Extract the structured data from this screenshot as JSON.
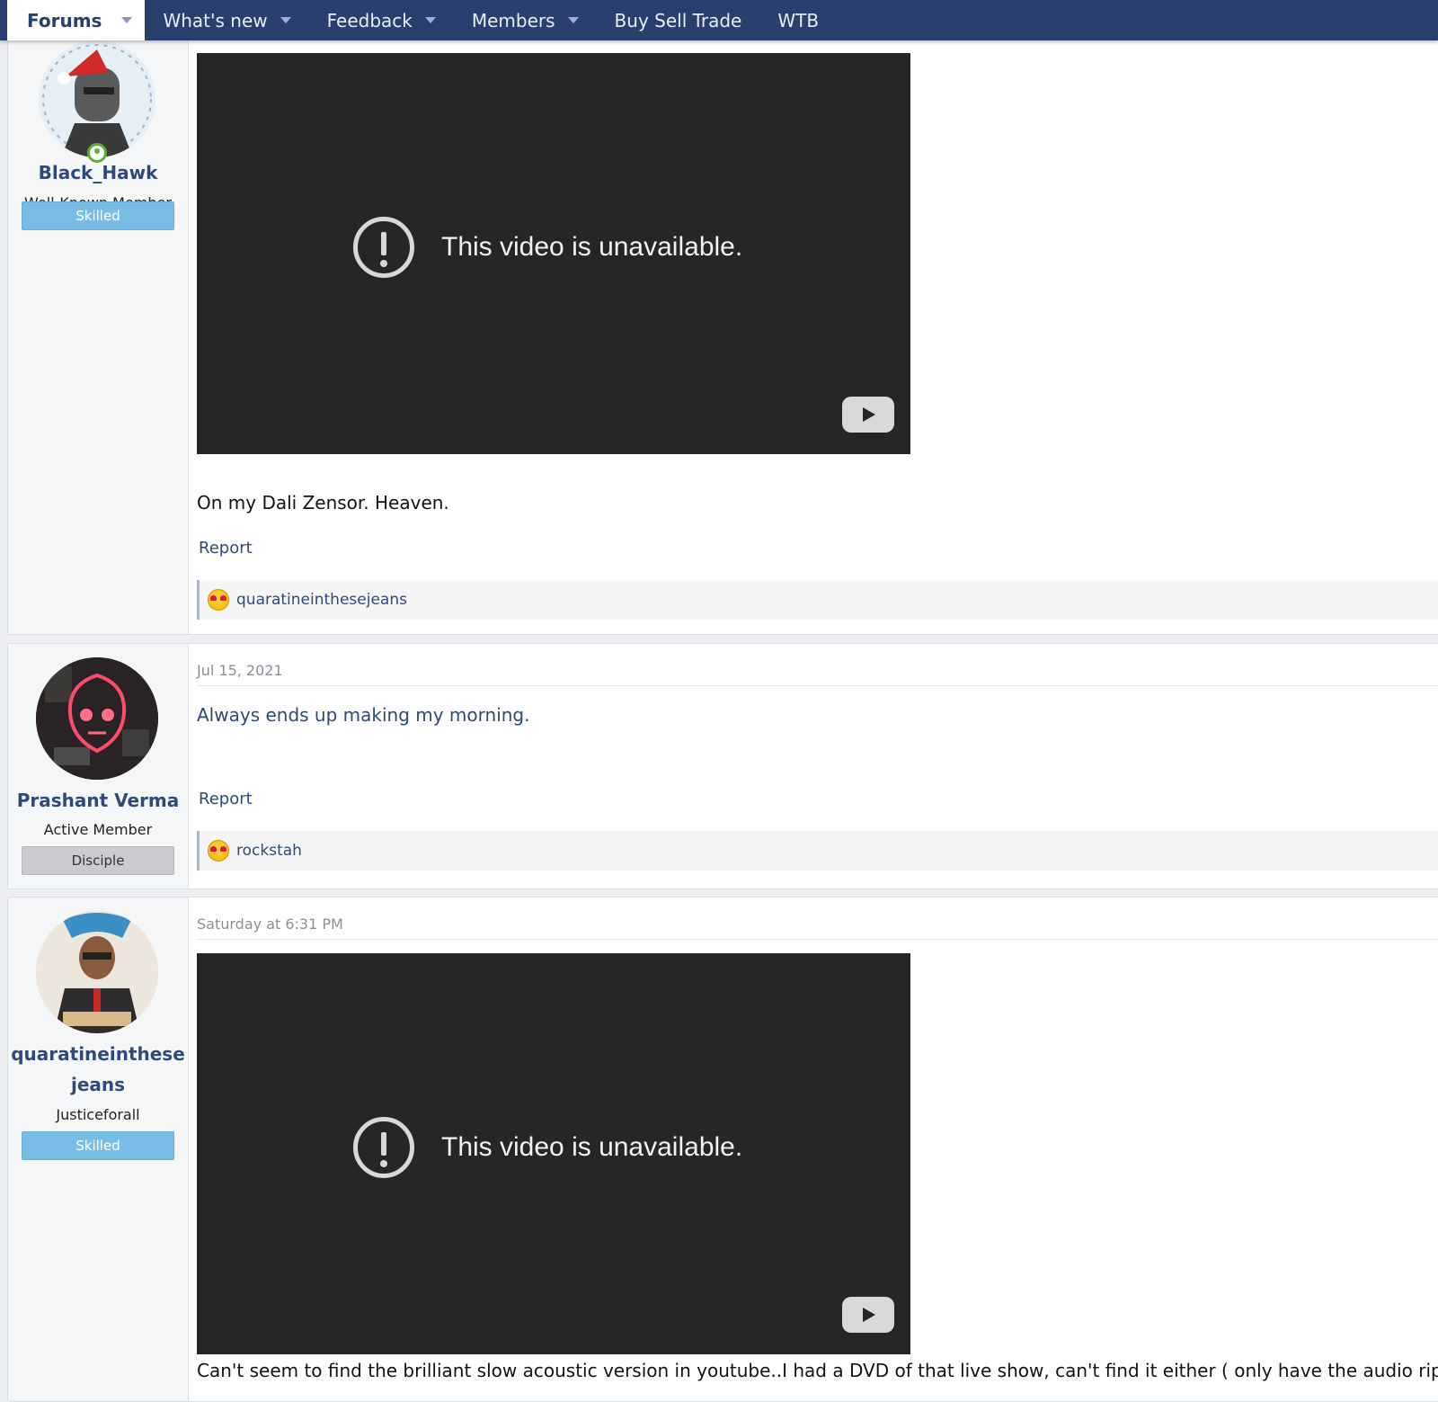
{
  "nav": {
    "items": [
      {
        "label": "Forums",
        "has_menu": true,
        "active": true
      },
      {
        "label": "What's new",
        "has_menu": true
      },
      {
        "label": "Feedback",
        "has_menu": true
      },
      {
        "label": "Members",
        "has_menu": true
      },
      {
        "label": "Buy Sell Trade",
        "has_menu": false
      },
      {
        "label": "WTB",
        "has_menu": false
      }
    ]
  },
  "posts": [
    {
      "user": {
        "name": "Black_Hawk",
        "title": "Well-Known Member",
        "banner": "Skilled",
        "online": true
      },
      "video": {
        "message": "This video is unavailable."
      },
      "body": "On my Dali Zensor. Heaven.",
      "report": "Report",
      "reactions": {
        "users": "quaratineinthesejeans"
      }
    },
    {
      "user": {
        "name": "Prashant Verma",
        "title": "Active Member",
        "banner": "Disciple"
      },
      "date": "Jul 15, 2021",
      "body": "Always ends up making my morning.",
      "report": "Report",
      "reactions": {
        "users": "rockstah"
      }
    },
    {
      "user": {
        "name_line1": "quaratineinthese",
        "name_line2": "jeans",
        "title": "Justiceforall",
        "banner": "Skilled"
      },
      "date": "Saturday at 6:31 PM",
      "video": {
        "message": "This video is unavailable."
      },
      "body": "Can't seem to find the brilliant slow acoustic version in youtube..I had a DVD of that live show, can't find it either ( only have the audio rip)"
    }
  ],
  "colors": {
    "nav_bg": "#2b3f6e",
    "link": "#2f4a7a",
    "banner_skilled": "#78bde6",
    "banner_disciple": "#c9cbce",
    "video_bg": "#262626"
  }
}
